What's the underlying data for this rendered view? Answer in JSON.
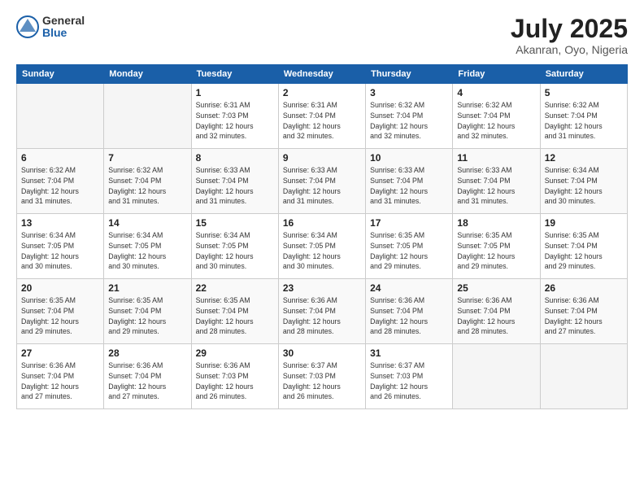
{
  "logo": {
    "general": "General",
    "blue": "Blue"
  },
  "header": {
    "month_year": "July 2025",
    "location": "Akanran, Oyo, Nigeria"
  },
  "days_of_week": [
    "Sunday",
    "Monday",
    "Tuesday",
    "Wednesday",
    "Thursday",
    "Friday",
    "Saturday"
  ],
  "weeks": [
    [
      {
        "day": "",
        "info": ""
      },
      {
        "day": "",
        "info": ""
      },
      {
        "day": "1",
        "info": "Sunrise: 6:31 AM\nSunset: 7:03 PM\nDaylight: 12 hours\nand 32 minutes."
      },
      {
        "day": "2",
        "info": "Sunrise: 6:31 AM\nSunset: 7:04 PM\nDaylight: 12 hours\nand 32 minutes."
      },
      {
        "day": "3",
        "info": "Sunrise: 6:32 AM\nSunset: 7:04 PM\nDaylight: 12 hours\nand 32 minutes."
      },
      {
        "day": "4",
        "info": "Sunrise: 6:32 AM\nSunset: 7:04 PM\nDaylight: 12 hours\nand 32 minutes."
      },
      {
        "day": "5",
        "info": "Sunrise: 6:32 AM\nSunset: 7:04 PM\nDaylight: 12 hours\nand 31 minutes."
      }
    ],
    [
      {
        "day": "6",
        "info": "Sunrise: 6:32 AM\nSunset: 7:04 PM\nDaylight: 12 hours\nand 31 minutes."
      },
      {
        "day": "7",
        "info": "Sunrise: 6:32 AM\nSunset: 7:04 PM\nDaylight: 12 hours\nand 31 minutes."
      },
      {
        "day": "8",
        "info": "Sunrise: 6:33 AM\nSunset: 7:04 PM\nDaylight: 12 hours\nand 31 minutes."
      },
      {
        "day": "9",
        "info": "Sunrise: 6:33 AM\nSunset: 7:04 PM\nDaylight: 12 hours\nand 31 minutes."
      },
      {
        "day": "10",
        "info": "Sunrise: 6:33 AM\nSunset: 7:04 PM\nDaylight: 12 hours\nand 31 minutes."
      },
      {
        "day": "11",
        "info": "Sunrise: 6:33 AM\nSunset: 7:04 PM\nDaylight: 12 hours\nand 31 minutes."
      },
      {
        "day": "12",
        "info": "Sunrise: 6:34 AM\nSunset: 7:04 PM\nDaylight: 12 hours\nand 30 minutes."
      }
    ],
    [
      {
        "day": "13",
        "info": "Sunrise: 6:34 AM\nSunset: 7:05 PM\nDaylight: 12 hours\nand 30 minutes."
      },
      {
        "day": "14",
        "info": "Sunrise: 6:34 AM\nSunset: 7:05 PM\nDaylight: 12 hours\nand 30 minutes."
      },
      {
        "day": "15",
        "info": "Sunrise: 6:34 AM\nSunset: 7:05 PM\nDaylight: 12 hours\nand 30 minutes."
      },
      {
        "day": "16",
        "info": "Sunrise: 6:34 AM\nSunset: 7:05 PM\nDaylight: 12 hours\nand 30 minutes."
      },
      {
        "day": "17",
        "info": "Sunrise: 6:35 AM\nSunset: 7:05 PM\nDaylight: 12 hours\nand 29 minutes."
      },
      {
        "day": "18",
        "info": "Sunrise: 6:35 AM\nSunset: 7:05 PM\nDaylight: 12 hours\nand 29 minutes."
      },
      {
        "day": "19",
        "info": "Sunrise: 6:35 AM\nSunset: 7:04 PM\nDaylight: 12 hours\nand 29 minutes."
      }
    ],
    [
      {
        "day": "20",
        "info": "Sunrise: 6:35 AM\nSunset: 7:04 PM\nDaylight: 12 hours\nand 29 minutes."
      },
      {
        "day": "21",
        "info": "Sunrise: 6:35 AM\nSunset: 7:04 PM\nDaylight: 12 hours\nand 29 minutes."
      },
      {
        "day": "22",
        "info": "Sunrise: 6:35 AM\nSunset: 7:04 PM\nDaylight: 12 hours\nand 28 minutes."
      },
      {
        "day": "23",
        "info": "Sunrise: 6:36 AM\nSunset: 7:04 PM\nDaylight: 12 hours\nand 28 minutes."
      },
      {
        "day": "24",
        "info": "Sunrise: 6:36 AM\nSunset: 7:04 PM\nDaylight: 12 hours\nand 28 minutes."
      },
      {
        "day": "25",
        "info": "Sunrise: 6:36 AM\nSunset: 7:04 PM\nDaylight: 12 hours\nand 28 minutes."
      },
      {
        "day": "26",
        "info": "Sunrise: 6:36 AM\nSunset: 7:04 PM\nDaylight: 12 hours\nand 27 minutes."
      }
    ],
    [
      {
        "day": "27",
        "info": "Sunrise: 6:36 AM\nSunset: 7:04 PM\nDaylight: 12 hours\nand 27 minutes."
      },
      {
        "day": "28",
        "info": "Sunrise: 6:36 AM\nSunset: 7:04 PM\nDaylight: 12 hours\nand 27 minutes."
      },
      {
        "day": "29",
        "info": "Sunrise: 6:36 AM\nSunset: 7:03 PM\nDaylight: 12 hours\nand 26 minutes."
      },
      {
        "day": "30",
        "info": "Sunrise: 6:37 AM\nSunset: 7:03 PM\nDaylight: 12 hours\nand 26 minutes."
      },
      {
        "day": "31",
        "info": "Sunrise: 6:37 AM\nSunset: 7:03 PM\nDaylight: 12 hours\nand 26 minutes."
      },
      {
        "day": "",
        "info": ""
      },
      {
        "day": "",
        "info": ""
      }
    ]
  ]
}
